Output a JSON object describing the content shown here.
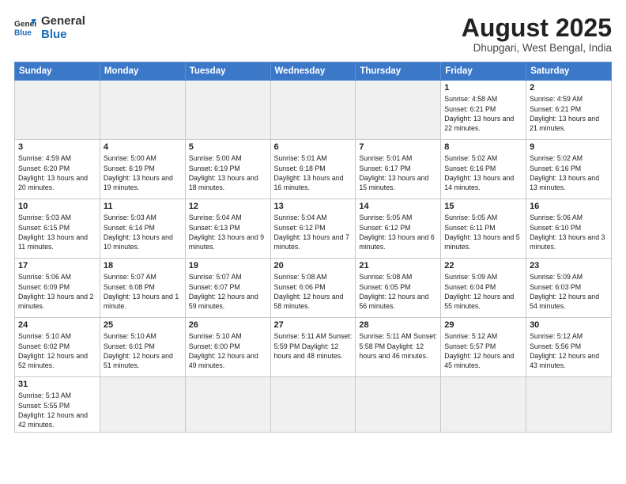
{
  "header": {
    "logo_general": "General",
    "logo_blue": "Blue",
    "month_title": "August 2025",
    "location": "Dhupgari, West Bengal, India"
  },
  "weekdays": [
    "Sunday",
    "Monday",
    "Tuesday",
    "Wednesday",
    "Thursday",
    "Friday",
    "Saturday"
  ],
  "weeks": [
    [
      {
        "day": "",
        "info": ""
      },
      {
        "day": "",
        "info": ""
      },
      {
        "day": "",
        "info": ""
      },
      {
        "day": "",
        "info": ""
      },
      {
        "day": "",
        "info": ""
      },
      {
        "day": "1",
        "info": "Sunrise: 4:58 AM\nSunset: 6:21 PM\nDaylight: 13 hours\nand 22 minutes."
      },
      {
        "day": "2",
        "info": "Sunrise: 4:59 AM\nSunset: 6:21 PM\nDaylight: 13 hours\nand 21 minutes."
      }
    ],
    [
      {
        "day": "3",
        "info": "Sunrise: 4:59 AM\nSunset: 6:20 PM\nDaylight: 13 hours\nand 20 minutes."
      },
      {
        "day": "4",
        "info": "Sunrise: 5:00 AM\nSunset: 6:19 PM\nDaylight: 13 hours\nand 19 minutes."
      },
      {
        "day": "5",
        "info": "Sunrise: 5:00 AM\nSunset: 6:19 PM\nDaylight: 13 hours\nand 18 minutes."
      },
      {
        "day": "6",
        "info": "Sunrise: 5:01 AM\nSunset: 6:18 PM\nDaylight: 13 hours\nand 16 minutes."
      },
      {
        "day": "7",
        "info": "Sunrise: 5:01 AM\nSunset: 6:17 PM\nDaylight: 13 hours\nand 15 minutes."
      },
      {
        "day": "8",
        "info": "Sunrise: 5:02 AM\nSunset: 6:16 PM\nDaylight: 13 hours\nand 14 minutes."
      },
      {
        "day": "9",
        "info": "Sunrise: 5:02 AM\nSunset: 6:16 PM\nDaylight: 13 hours\nand 13 minutes."
      }
    ],
    [
      {
        "day": "10",
        "info": "Sunrise: 5:03 AM\nSunset: 6:15 PM\nDaylight: 13 hours\nand 11 minutes."
      },
      {
        "day": "11",
        "info": "Sunrise: 5:03 AM\nSunset: 6:14 PM\nDaylight: 13 hours\nand 10 minutes."
      },
      {
        "day": "12",
        "info": "Sunrise: 5:04 AM\nSunset: 6:13 PM\nDaylight: 13 hours\nand 9 minutes."
      },
      {
        "day": "13",
        "info": "Sunrise: 5:04 AM\nSunset: 6:12 PM\nDaylight: 13 hours\nand 7 minutes."
      },
      {
        "day": "14",
        "info": "Sunrise: 5:05 AM\nSunset: 6:12 PM\nDaylight: 13 hours\nand 6 minutes."
      },
      {
        "day": "15",
        "info": "Sunrise: 5:05 AM\nSunset: 6:11 PM\nDaylight: 13 hours\nand 5 minutes."
      },
      {
        "day": "16",
        "info": "Sunrise: 5:06 AM\nSunset: 6:10 PM\nDaylight: 13 hours\nand 3 minutes."
      }
    ],
    [
      {
        "day": "17",
        "info": "Sunrise: 5:06 AM\nSunset: 6:09 PM\nDaylight: 13 hours\nand 2 minutes."
      },
      {
        "day": "18",
        "info": "Sunrise: 5:07 AM\nSunset: 6:08 PM\nDaylight: 13 hours\nand 1 minute."
      },
      {
        "day": "19",
        "info": "Sunrise: 5:07 AM\nSunset: 6:07 PM\nDaylight: 12 hours\nand 59 minutes."
      },
      {
        "day": "20",
        "info": "Sunrise: 5:08 AM\nSunset: 6:06 PM\nDaylight: 12 hours\nand 58 minutes."
      },
      {
        "day": "21",
        "info": "Sunrise: 5:08 AM\nSunset: 6:05 PM\nDaylight: 12 hours\nand 56 minutes."
      },
      {
        "day": "22",
        "info": "Sunrise: 5:09 AM\nSunset: 6:04 PM\nDaylight: 12 hours\nand 55 minutes."
      },
      {
        "day": "23",
        "info": "Sunrise: 5:09 AM\nSunset: 6:03 PM\nDaylight: 12 hours\nand 54 minutes."
      }
    ],
    [
      {
        "day": "24",
        "info": "Sunrise: 5:10 AM\nSunset: 6:02 PM\nDaylight: 12 hours\nand 52 minutes."
      },
      {
        "day": "25",
        "info": "Sunrise: 5:10 AM\nSunset: 6:01 PM\nDaylight: 12 hours\nand 51 minutes."
      },
      {
        "day": "26",
        "info": "Sunrise: 5:10 AM\nSunset: 6:00 PM\nDaylight: 12 hours\nand 49 minutes."
      },
      {
        "day": "27",
        "info": "Sunrise: 5:11 AM\nSunset: 5:59 PM\nDaylight: 12 hours\nand 48 minutes."
      },
      {
        "day": "28",
        "info": "Sunrise: 5:11 AM\nSunset: 5:58 PM\nDaylight: 12 hours\nand 46 minutes."
      },
      {
        "day": "29",
        "info": "Sunrise: 5:12 AM\nSunset: 5:57 PM\nDaylight: 12 hours\nand 45 minutes."
      },
      {
        "day": "30",
        "info": "Sunrise: 5:12 AM\nSunset: 5:56 PM\nDaylight: 12 hours\nand 43 minutes."
      }
    ],
    [
      {
        "day": "31",
        "info": "Sunrise: 5:13 AM\nSunset: 5:55 PM\nDaylight: 12 hours\nand 42 minutes."
      },
      {
        "day": "",
        "info": ""
      },
      {
        "day": "",
        "info": ""
      },
      {
        "day": "",
        "info": ""
      },
      {
        "day": "",
        "info": ""
      },
      {
        "day": "",
        "info": ""
      },
      {
        "day": "",
        "info": ""
      }
    ]
  ]
}
